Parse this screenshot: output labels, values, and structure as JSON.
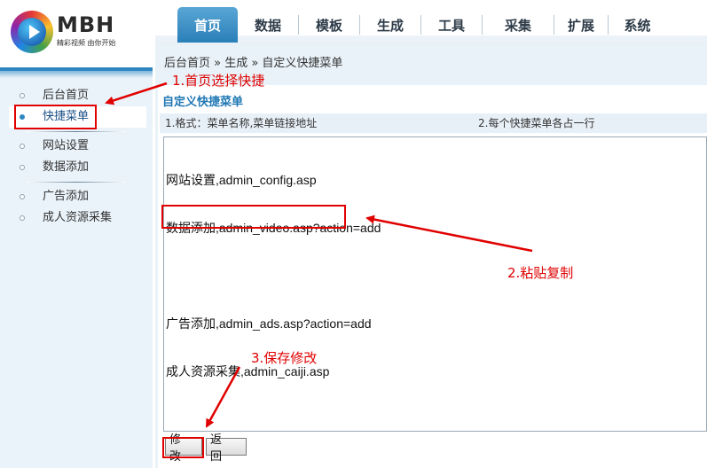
{
  "logo": {
    "text": "MBH",
    "slogan": "精彩视频 由你开始"
  },
  "nav": {
    "tabs": [
      {
        "label": "首页",
        "active": true
      },
      {
        "label": "数据",
        "active": false
      },
      {
        "label": "模板",
        "active": false
      },
      {
        "label": "生成",
        "active": false
      },
      {
        "label": "工具",
        "active": false
      },
      {
        "label": "采集",
        "active": false
      },
      {
        "label": "扩展",
        "active": false
      },
      {
        "label": "系统",
        "active": false
      }
    ]
  },
  "sidebar": {
    "items": [
      {
        "label": "后台首页"
      },
      {
        "label": "快捷菜单"
      },
      {
        "label": "网站设置"
      },
      {
        "label": "数据添加"
      },
      {
        "label": "广告添加"
      },
      {
        "label": "成人资源采集"
      }
    ]
  },
  "breadcrumb": "后台首页 » 生成 » 自定义快捷菜单",
  "panel": {
    "title": "自定义快捷菜单",
    "hint_left": "1.格式：菜单名称,菜单链接地址",
    "hint_right": "2.每个快捷菜单各占一行",
    "editor_lines": [
      "网站设置,admin_config.asp",
      "数据添加,admin_video.asp?action=add",
      "",
      "广告添加,admin_ads.asp?action=add",
      "成人资源采集,admin_caiji.asp"
    ],
    "save_label": "修改",
    "back_label": "返回"
  },
  "annotations": {
    "note1": "1.首页选择快捷",
    "note2": "2.粘贴复制",
    "note3": "3.保存修改",
    "color": "#e00000"
  },
  "colors": {
    "accent": "#2f86c2",
    "title": "#1f78b4"
  }
}
